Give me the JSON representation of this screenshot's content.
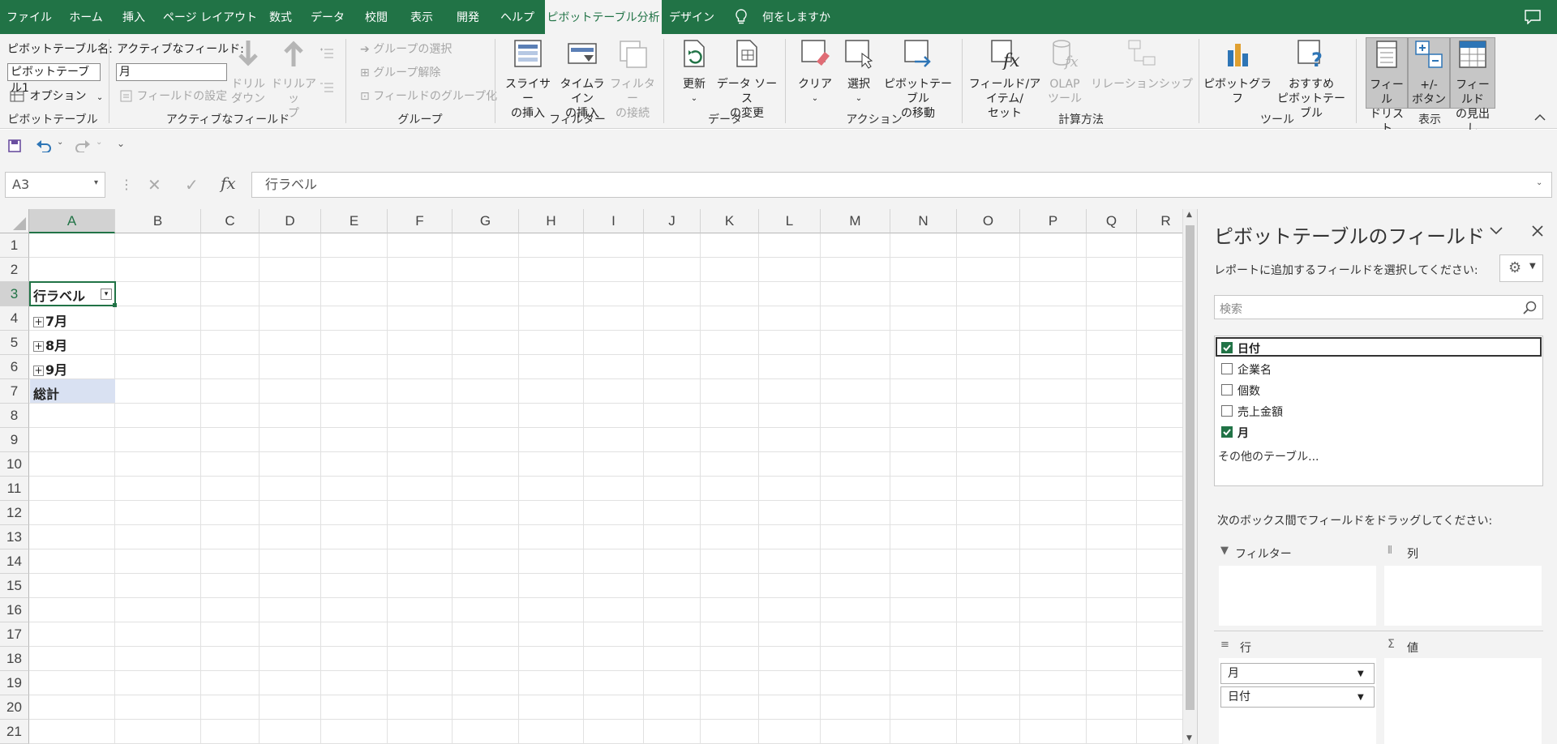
{
  "ribbon_tabs": [
    "ファイル",
    "ホーム",
    "挿入",
    "ページ レイアウト",
    "数式",
    "データ",
    "校閲",
    "表示",
    "開発",
    "ヘルプ",
    "ピボットテーブル分析",
    "デザイン"
  ],
  "active_tab": "ピボットテーブル分析",
  "tell_me": "何をしますか",
  "ribbon": {
    "pivot_name_label": "ピボットテーブル名:",
    "pivot_name_value": "ピボットテーブル1",
    "options_label": "オプション",
    "group_pivot": "ピボットテーブル",
    "active_field_label": "アクティブなフィールド:",
    "active_field_value": "月",
    "field_settings": "フィールドの設定",
    "drill_down": [
      "ドリル",
      "ダウン"
    ],
    "drill_up": [
      "ドリルアッ",
      "プ"
    ],
    "group_active_field": "アクティブなフィールド",
    "group_selection": "グループの選択",
    "ungroup": "グループ解除",
    "group_field": "フィールドのグループ化",
    "group_group": "グループ",
    "insert_slicer": [
      "スライサー",
      "の挿入"
    ],
    "insert_timeline": [
      "タイムライン",
      "の挿入"
    ],
    "filter_connections": [
      "フィルター",
      "の接続"
    ],
    "group_filter": "フィルター",
    "refresh": "更新",
    "change_source": [
      "データ ソース",
      "の変更"
    ],
    "group_data": "データ",
    "clear": "クリア",
    "select": "選択",
    "move_pivot": [
      "ピボットテーブル",
      "の移動"
    ],
    "group_actions": "アクション",
    "fields_items": [
      "フィールド/アイテム/",
      "セット"
    ],
    "olap_tools": [
      "OLAP",
      "ツール"
    ],
    "relationships": "リレーションシップ",
    "group_calc": "計算方法",
    "pivot_chart": "ピボットグラフ",
    "recommended_pivot": [
      "おすすめ",
      "ピボットテーブル"
    ],
    "group_tools": "ツール",
    "field_list": [
      "フィール",
      "ドリスト"
    ],
    "plus_minus_buttons": [
      "+/-",
      "ボタン"
    ],
    "field_headers": [
      "フィールド",
      "の見出し"
    ],
    "group_show": "表示"
  },
  "formula_bar": {
    "name_box": "A3",
    "formula": "行ラベル"
  },
  "columns": [
    "A",
    "B",
    "C",
    "D",
    "E",
    "F",
    "G",
    "H",
    "I",
    "J",
    "K",
    "L",
    "M",
    "N",
    "O",
    "P",
    "Q",
    "R"
  ],
  "rows": [
    "1",
    "2",
    "3",
    "4",
    "5",
    "6",
    "7",
    "8",
    "9",
    "10",
    "11",
    "12",
    "13",
    "14",
    "15",
    "16",
    "17",
    "18",
    "19",
    "20",
    "21"
  ],
  "cells": {
    "a3": "行ラベル",
    "a4": "7月",
    "a5": "8月",
    "a6": "9月",
    "a7": "総計"
  },
  "pane": {
    "title": "ピボットテーブルのフィールド",
    "subtitle": "レポートに追加するフィールドを選択してください:",
    "search_placeholder": "検索",
    "fields": [
      {
        "label": "日付",
        "checked": true
      },
      {
        "label": "企業名",
        "checked": false
      },
      {
        "label": "個数",
        "checked": false
      },
      {
        "label": "売上金額",
        "checked": false
      },
      {
        "label": "月",
        "checked": true
      }
    ],
    "more_tables": "その他のテーブル...",
    "drag_hint": "次のボックス間でフィールドをドラッグしてください:",
    "area_filter": "フィルター",
    "area_columns": "列",
    "area_rows": "行",
    "area_values": "値",
    "row_pills": [
      "月",
      "日付"
    ]
  },
  "colors": {
    "accent": "#217346",
    "selection_fill": "#d9e1f2"
  }
}
